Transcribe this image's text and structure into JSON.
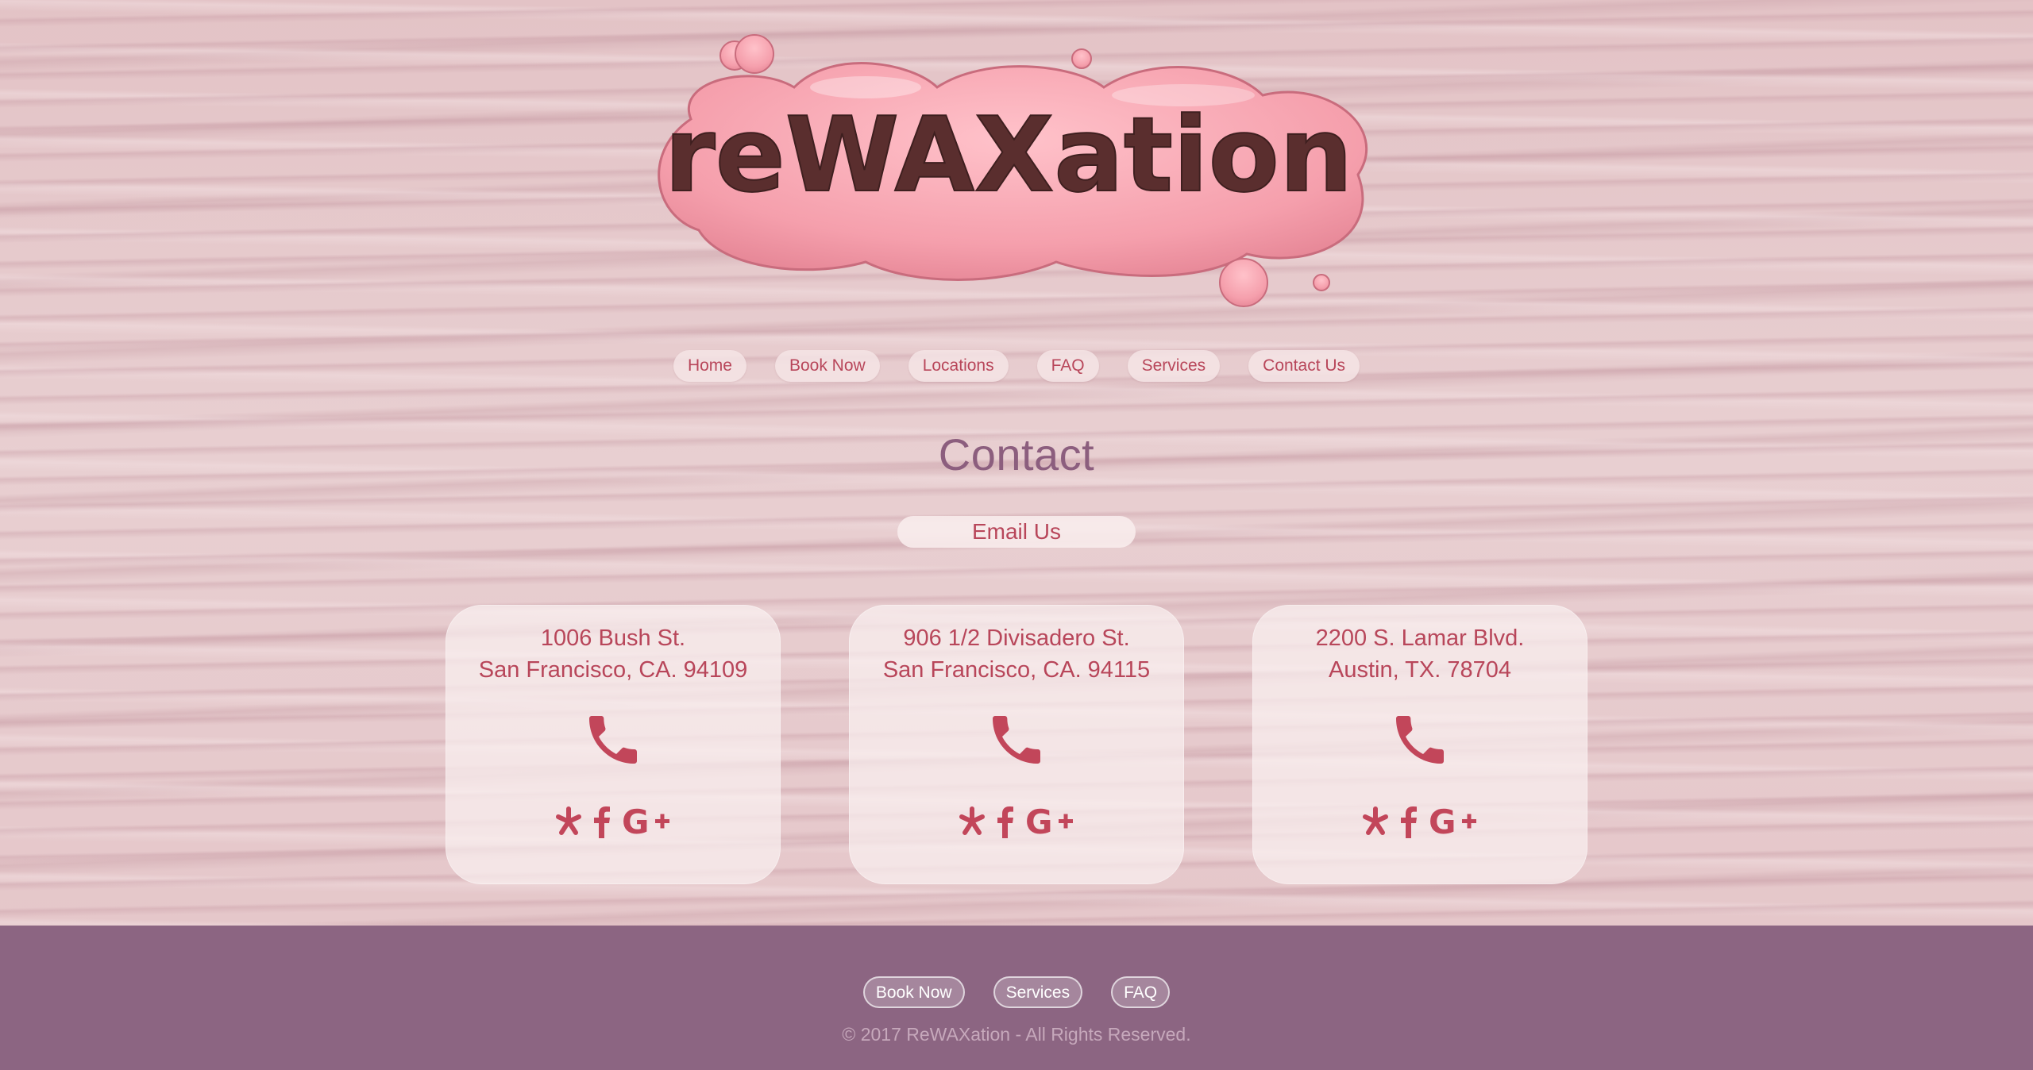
{
  "brand": {
    "logo_text": "reWAXation"
  },
  "nav": {
    "items": [
      {
        "label": "Home"
      },
      {
        "label": "Book Now"
      },
      {
        "label": "Locations"
      },
      {
        "label": "FAQ"
      },
      {
        "label": "Services"
      },
      {
        "label": "Contact Us"
      }
    ]
  },
  "page": {
    "title": "Contact",
    "email_button": "Email Us"
  },
  "locations": [
    {
      "line1": "1006 Bush St.",
      "line2": "San Francisco, CA. 94109"
    },
    {
      "line1": "906 1/2 Divisadero St.",
      "line2": "San Francisco, CA. 94115"
    },
    {
      "line1": "2200 S. Lamar Blvd.",
      "line2": "Austin, TX. 78704"
    }
  ],
  "icons": {
    "phone": "phone-icon",
    "yelp": "yelp-icon",
    "facebook": "facebook-icon",
    "googleplus": "google-plus-icon"
  },
  "footer": {
    "links": [
      {
        "label": "Book Now"
      },
      {
        "label": "Services"
      },
      {
        "label": "FAQ"
      }
    ],
    "copyright": "© 2017 ReWAXation - All Rights Reserved."
  },
  "colors": {
    "accent": "#b8465a",
    "footer_bg": "#8c6582",
    "title": "#8c5e7e"
  }
}
